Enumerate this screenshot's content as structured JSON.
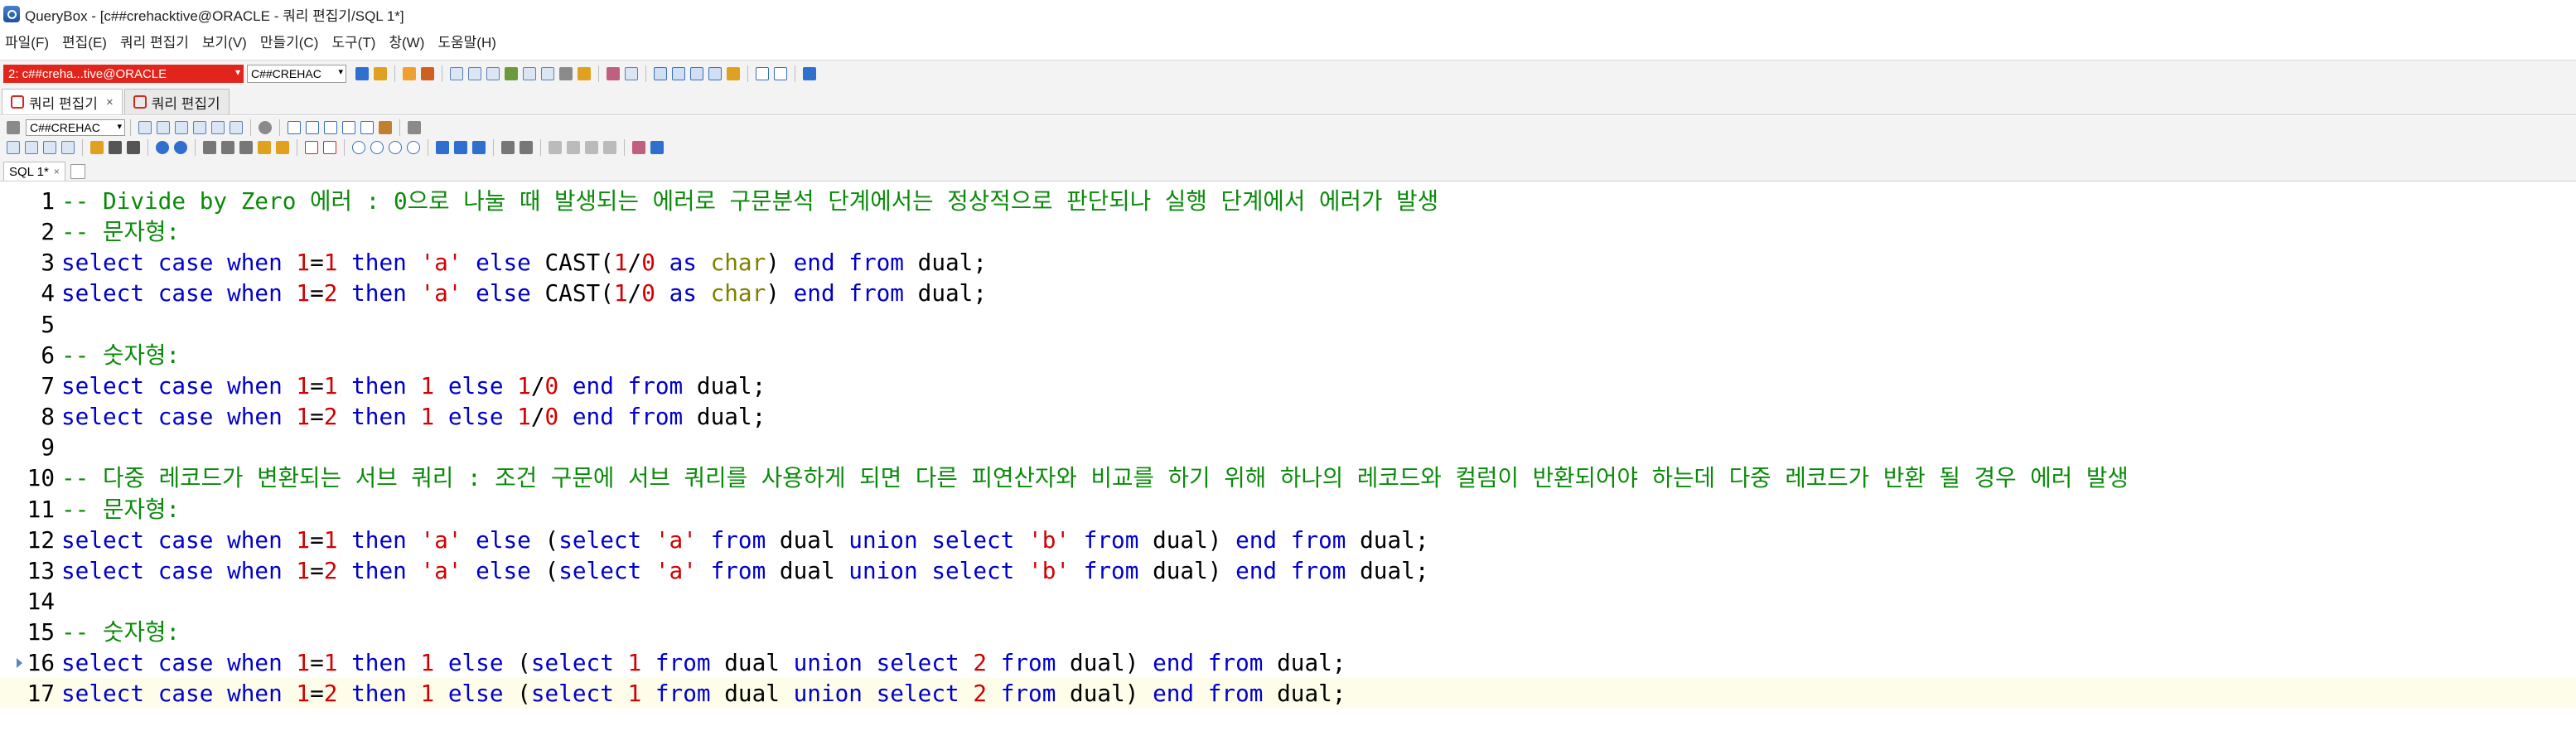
{
  "window": {
    "title": "QueryBox - [c##crehacktive@ORACLE - 쿼리 편집기/SQL 1*]"
  },
  "menu": [
    "파일(F)",
    "편집(E)",
    "쿼리 편집기",
    "보기(V)",
    "만들기(C)",
    "도구(T)",
    "창(W)",
    "도움말(H)"
  ],
  "toolbar": {
    "connection": "2: c##creha...tive@ORACLE",
    "schema": "C##CREHAC",
    "connection_color": "#e1241c"
  },
  "tabs": [
    {
      "label": "쿼리 편집기",
      "active": true
    },
    {
      "label": "쿼리 편집기",
      "active": false
    }
  ],
  "toolbar2": {
    "schema": "C##CREHAC"
  },
  "sql_tab": "SQL 1*",
  "editor": {
    "current_line": 17,
    "colors": {
      "comment": "#0a8a0a",
      "keyword": "#0000cc",
      "number": "#d20000",
      "string": "#d20000",
      "type": "#808000"
    },
    "lines": [
      {
        "n": "1",
        "tokens": [
          [
            "cm",
            "-- Divide by Zero 에러 : 0으로 나눌 때 발생되는 에러로 구문분석 단계에서는 정상적으로 판단되나 실행 단계에서 에러가 발생"
          ]
        ]
      },
      {
        "n": "2",
        "tokens": [
          [
            "cm",
            "-- 문자형:"
          ]
        ]
      },
      {
        "n": "3",
        "tokens": [
          [
            "kw",
            "select"
          ],
          [
            "id",
            " "
          ],
          [
            "kw",
            "case"
          ],
          [
            "id",
            " "
          ],
          [
            "kw",
            "when"
          ],
          [
            "id",
            " "
          ],
          [
            "num",
            "1"
          ],
          [
            "op",
            "="
          ],
          [
            "num",
            "1"
          ],
          [
            "id",
            " "
          ],
          [
            "kw",
            "then"
          ],
          [
            "id",
            " "
          ],
          [
            "str",
            "'a'"
          ],
          [
            "id",
            " "
          ],
          [
            "kw",
            "else"
          ],
          [
            "id",
            " "
          ],
          [
            "fn",
            "CAST"
          ],
          [
            "op",
            "("
          ],
          [
            "num",
            "1"
          ],
          [
            "op",
            "/"
          ],
          [
            "num",
            "0"
          ],
          [
            "id",
            " "
          ],
          [
            "kw",
            "as"
          ],
          [
            "id",
            " "
          ],
          [
            "ty",
            "char"
          ],
          [
            "op",
            ")"
          ],
          [
            "id",
            " "
          ],
          [
            "kw",
            "end"
          ],
          [
            "id",
            " "
          ],
          [
            "kw",
            "from"
          ],
          [
            "id",
            " dual;"
          ]
        ]
      },
      {
        "n": "4",
        "tokens": [
          [
            "kw",
            "select"
          ],
          [
            "id",
            " "
          ],
          [
            "kw",
            "case"
          ],
          [
            "id",
            " "
          ],
          [
            "kw",
            "when"
          ],
          [
            "id",
            " "
          ],
          [
            "num",
            "1"
          ],
          [
            "op",
            "="
          ],
          [
            "num",
            "2"
          ],
          [
            "id",
            " "
          ],
          [
            "kw",
            "then"
          ],
          [
            "id",
            " "
          ],
          [
            "str",
            "'a'"
          ],
          [
            "id",
            " "
          ],
          [
            "kw",
            "else"
          ],
          [
            "id",
            " "
          ],
          [
            "fn",
            "CAST"
          ],
          [
            "op",
            "("
          ],
          [
            "num",
            "1"
          ],
          [
            "op",
            "/"
          ],
          [
            "num",
            "0"
          ],
          [
            "id",
            " "
          ],
          [
            "kw",
            "as"
          ],
          [
            "id",
            " "
          ],
          [
            "ty",
            "char"
          ],
          [
            "op",
            ")"
          ],
          [
            "id",
            " "
          ],
          [
            "kw",
            "end"
          ],
          [
            "id",
            " "
          ],
          [
            "kw",
            "from"
          ],
          [
            "id",
            " dual;"
          ]
        ]
      },
      {
        "n": "5",
        "tokens": []
      },
      {
        "n": "6",
        "tokens": [
          [
            "cm",
            "-- 숫자형:"
          ]
        ]
      },
      {
        "n": "7",
        "tokens": [
          [
            "kw",
            "select"
          ],
          [
            "id",
            " "
          ],
          [
            "kw",
            "case"
          ],
          [
            "id",
            " "
          ],
          [
            "kw",
            "when"
          ],
          [
            "id",
            " "
          ],
          [
            "num",
            "1"
          ],
          [
            "op",
            "="
          ],
          [
            "num",
            "1"
          ],
          [
            "id",
            " "
          ],
          [
            "kw",
            "then"
          ],
          [
            "id",
            " "
          ],
          [
            "num",
            "1"
          ],
          [
            "id",
            " "
          ],
          [
            "kw",
            "else"
          ],
          [
            "id",
            " "
          ],
          [
            "num",
            "1"
          ],
          [
            "op",
            "/"
          ],
          [
            "num",
            "0"
          ],
          [
            "id",
            " "
          ],
          [
            "kw",
            "end"
          ],
          [
            "id",
            " "
          ],
          [
            "kw",
            "from"
          ],
          [
            "id",
            " dual;"
          ]
        ]
      },
      {
        "n": "8",
        "tokens": [
          [
            "kw",
            "select"
          ],
          [
            "id",
            " "
          ],
          [
            "kw",
            "case"
          ],
          [
            "id",
            " "
          ],
          [
            "kw",
            "when"
          ],
          [
            "id",
            " "
          ],
          [
            "num",
            "1"
          ],
          [
            "op",
            "="
          ],
          [
            "num",
            "2"
          ],
          [
            "id",
            " "
          ],
          [
            "kw",
            "then"
          ],
          [
            "id",
            " "
          ],
          [
            "num",
            "1"
          ],
          [
            "id",
            " "
          ],
          [
            "kw",
            "else"
          ],
          [
            "id",
            " "
          ],
          [
            "num",
            "1"
          ],
          [
            "op",
            "/"
          ],
          [
            "num",
            "0"
          ],
          [
            "id",
            " "
          ],
          [
            "kw",
            "end"
          ],
          [
            "id",
            " "
          ],
          [
            "kw",
            "from"
          ],
          [
            "id",
            " dual;"
          ]
        ]
      },
      {
        "n": "9",
        "tokens": []
      },
      {
        "n": "10",
        "tokens": [
          [
            "cm",
            "-- 다중 레코드가 변환되는 서브 쿼리 : 조건 구문에 서브 쿼리를 사용하게 되면 다른 피연산자와 비교를 하기 위해 하나의 레코드와 컬럼이 반환되어야 하는데 다중 레코드가 반환 될 경우 에러 발생"
          ]
        ]
      },
      {
        "n": "11",
        "tokens": [
          [
            "cm",
            "-- 문자형:"
          ]
        ]
      },
      {
        "n": "12",
        "tokens": [
          [
            "kw",
            "select"
          ],
          [
            "id",
            " "
          ],
          [
            "kw",
            "case"
          ],
          [
            "id",
            " "
          ],
          [
            "kw",
            "when"
          ],
          [
            "id",
            " "
          ],
          [
            "num",
            "1"
          ],
          [
            "op",
            "="
          ],
          [
            "num",
            "1"
          ],
          [
            "id",
            " "
          ],
          [
            "kw",
            "then"
          ],
          [
            "id",
            " "
          ],
          [
            "str",
            "'a'"
          ],
          [
            "id",
            " "
          ],
          [
            "kw",
            "else"
          ],
          [
            "id",
            " ("
          ],
          [
            "kw",
            "select"
          ],
          [
            "id",
            " "
          ],
          [
            "str",
            "'a'"
          ],
          [
            "id",
            " "
          ],
          [
            "kw",
            "from"
          ],
          [
            "id",
            " dual "
          ],
          [
            "kw",
            "union"
          ],
          [
            "id",
            " "
          ],
          [
            "kw",
            "select"
          ],
          [
            "id",
            " "
          ],
          [
            "str",
            "'b'"
          ],
          [
            "id",
            " "
          ],
          [
            "kw",
            "from"
          ],
          [
            "id",
            " dual) "
          ],
          [
            "kw",
            "end"
          ],
          [
            "id",
            " "
          ],
          [
            "kw",
            "from"
          ],
          [
            "id",
            " dual;"
          ]
        ]
      },
      {
        "n": "13",
        "tokens": [
          [
            "kw",
            "select"
          ],
          [
            "id",
            " "
          ],
          [
            "kw",
            "case"
          ],
          [
            "id",
            " "
          ],
          [
            "kw",
            "when"
          ],
          [
            "id",
            " "
          ],
          [
            "num",
            "1"
          ],
          [
            "op",
            "="
          ],
          [
            "num",
            "2"
          ],
          [
            "id",
            " "
          ],
          [
            "kw",
            "then"
          ],
          [
            "id",
            " "
          ],
          [
            "str",
            "'a'"
          ],
          [
            "id",
            " "
          ],
          [
            "kw",
            "else"
          ],
          [
            "id",
            " ("
          ],
          [
            "kw",
            "select"
          ],
          [
            "id",
            " "
          ],
          [
            "str",
            "'a'"
          ],
          [
            "id",
            " "
          ],
          [
            "kw",
            "from"
          ],
          [
            "id",
            " dual "
          ],
          [
            "kw",
            "union"
          ],
          [
            "id",
            " "
          ],
          [
            "kw",
            "select"
          ],
          [
            "id",
            " "
          ],
          [
            "str",
            "'b'"
          ],
          [
            "id",
            " "
          ],
          [
            "kw",
            "from"
          ],
          [
            "id",
            " dual) "
          ],
          [
            "kw",
            "end"
          ],
          [
            "id",
            " "
          ],
          [
            "kw",
            "from"
          ],
          [
            "id",
            " dual;"
          ]
        ]
      },
      {
        "n": "14",
        "tokens": []
      },
      {
        "n": "15",
        "tokens": [
          [
            "cm",
            "-- 숫자형:"
          ]
        ]
      },
      {
        "n": "16",
        "tokens": [
          [
            "kw",
            "select"
          ],
          [
            "id",
            " "
          ],
          [
            "kw",
            "case"
          ],
          [
            "id",
            " "
          ],
          [
            "kw",
            "when"
          ],
          [
            "id",
            " "
          ],
          [
            "num",
            "1"
          ],
          [
            "op",
            "="
          ],
          [
            "num",
            "1"
          ],
          [
            "id",
            " "
          ],
          [
            "kw",
            "then"
          ],
          [
            "id",
            " "
          ],
          [
            "num",
            "1"
          ],
          [
            "id",
            " "
          ],
          [
            "kw",
            "else"
          ],
          [
            "id",
            " ("
          ],
          [
            "kw",
            "select"
          ],
          [
            "id",
            " "
          ],
          [
            "num",
            "1"
          ],
          [
            "id",
            " "
          ],
          [
            "kw",
            "from"
          ],
          [
            "id",
            " dual "
          ],
          [
            "kw",
            "union"
          ],
          [
            "id",
            " "
          ],
          [
            "kw",
            "select"
          ],
          [
            "id",
            " "
          ],
          [
            "num",
            "2"
          ],
          [
            "id",
            " "
          ],
          [
            "kw",
            "from"
          ],
          [
            "id",
            " dual) "
          ],
          [
            "kw",
            "end"
          ],
          [
            "id",
            " "
          ],
          [
            "kw",
            "from"
          ],
          [
            "id",
            " dual;"
          ]
        ]
      },
      {
        "n": "17",
        "tokens": [
          [
            "kw",
            "select"
          ],
          [
            "id",
            " "
          ],
          [
            "kw",
            "case"
          ],
          [
            "id",
            " "
          ],
          [
            "kw",
            "when"
          ],
          [
            "id",
            " "
          ],
          [
            "num",
            "1"
          ],
          [
            "op",
            "="
          ],
          [
            "num",
            "2"
          ],
          [
            "id",
            " "
          ],
          [
            "kw",
            "then"
          ],
          [
            "id",
            " "
          ],
          [
            "num",
            "1"
          ],
          [
            "id",
            " "
          ],
          [
            "kw",
            "else"
          ],
          [
            "id",
            " ("
          ],
          [
            "kw",
            "select"
          ],
          [
            "id",
            " "
          ],
          [
            "num",
            "1"
          ],
          [
            "id",
            " "
          ],
          [
            "kw",
            "from"
          ],
          [
            "id",
            " dual "
          ],
          [
            "kw",
            "union"
          ],
          [
            "id",
            " "
          ],
          [
            "kw",
            "select"
          ],
          [
            "id",
            " "
          ],
          [
            "num",
            "2"
          ],
          [
            "id",
            " "
          ],
          [
            "kw",
            "from"
          ],
          [
            "id",
            " dual) "
          ],
          [
            "kw",
            "end"
          ],
          [
            "id",
            " "
          ],
          [
            "kw",
            "from"
          ],
          [
            "id",
            " dual;"
          ]
        ]
      }
    ]
  }
}
